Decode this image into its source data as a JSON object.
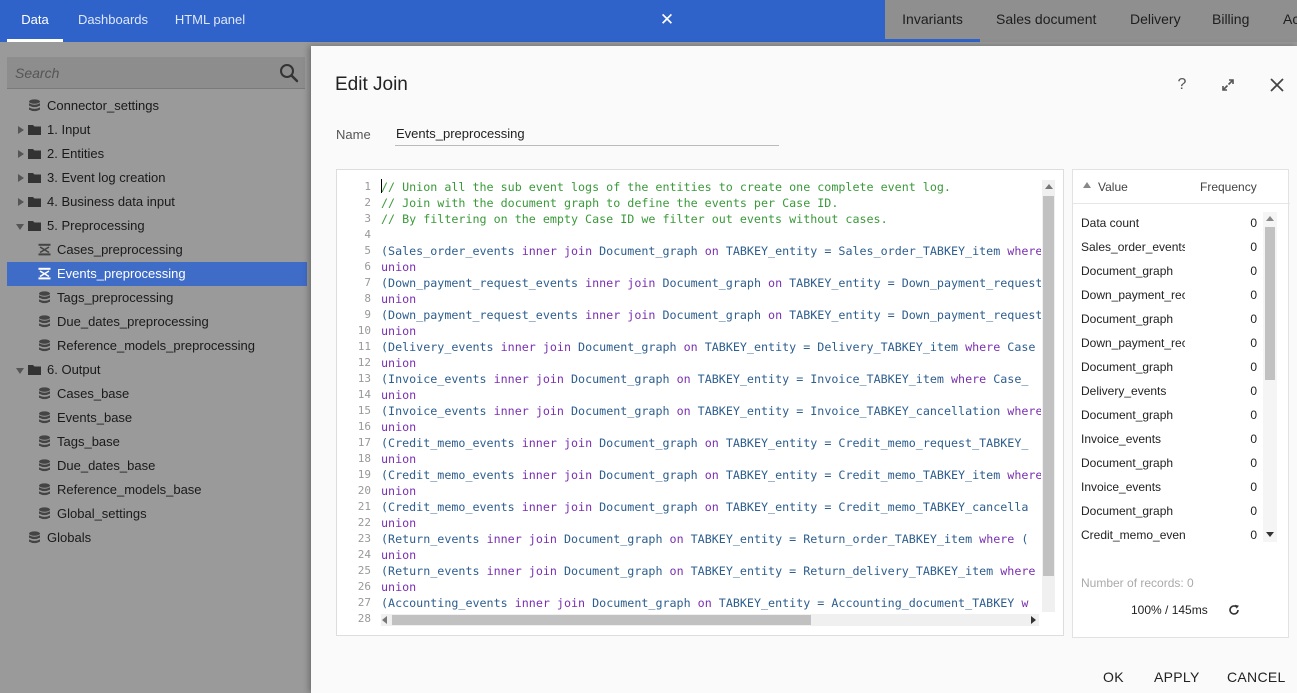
{
  "topbar": {
    "tabs": [
      "Data",
      "Dashboards",
      "HTML panel"
    ],
    "active_tab": "Data",
    "close_icon": "close-icon"
  },
  "right_tabs": [
    "Invariants",
    "Sales document",
    "Delivery",
    "Billing",
    "Ac"
  ],
  "search": {
    "placeholder": "Search",
    "value": ""
  },
  "tree": [
    {
      "label": "Connector_settings",
      "icon": "database-icon",
      "depth": 0,
      "arrow": "none"
    },
    {
      "label": "1. Input",
      "icon": "folder-icon",
      "depth": 0,
      "arrow": "right"
    },
    {
      "label": "2. Entities",
      "icon": "folder-icon",
      "depth": 0,
      "arrow": "right"
    },
    {
      "label": "3. Event log creation",
      "icon": "folder-icon",
      "depth": 0,
      "arrow": "right"
    },
    {
      "label": "4. Business data input",
      "icon": "folder-icon",
      "depth": 0,
      "arrow": "right"
    },
    {
      "label": "5. Preprocessing",
      "icon": "folder-icon",
      "depth": 0,
      "arrow": "down"
    },
    {
      "label": "Cases_preprocessing",
      "icon": "join-icon",
      "depth": 1,
      "arrow": "none"
    },
    {
      "label": "Events_preprocessing",
      "icon": "join-icon",
      "depth": 1,
      "arrow": "none",
      "selected": true
    },
    {
      "label": "Tags_preprocessing",
      "icon": "database-icon",
      "depth": 1,
      "arrow": "none"
    },
    {
      "label": "Due_dates_preprocessing",
      "icon": "database-icon",
      "depth": 1,
      "arrow": "none"
    },
    {
      "label": "Reference_models_preprocessing",
      "icon": "database-icon",
      "depth": 1,
      "arrow": "none"
    },
    {
      "label": "6. Output",
      "icon": "folder-icon",
      "depth": 0,
      "arrow": "down"
    },
    {
      "label": "Cases_base",
      "icon": "database-icon",
      "depth": 1,
      "arrow": "none"
    },
    {
      "label": "Events_base",
      "icon": "database-icon",
      "depth": 1,
      "arrow": "none"
    },
    {
      "label": "Tags_base",
      "icon": "database-icon",
      "depth": 1,
      "arrow": "none"
    },
    {
      "label": "Due_dates_base",
      "icon": "database-icon",
      "depth": 1,
      "arrow": "none"
    },
    {
      "label": "Reference_models_base",
      "icon": "database-icon",
      "depth": 1,
      "arrow": "none"
    },
    {
      "label": "Global_settings",
      "icon": "database-icon",
      "depth": 1,
      "arrow": "none"
    },
    {
      "label": "Globals",
      "icon": "database-icon",
      "depth": 0,
      "arrow": "none"
    }
  ],
  "dialog": {
    "title": "Edit Join",
    "help_label": "?",
    "name_label": "Name",
    "name_value": "Events_preprocessing",
    "buttons": {
      "ok": "OK",
      "apply": "APPLY",
      "cancel": "CANCEL"
    }
  },
  "code_lines": [
    [
      [
        "cm",
        "// Union all the sub event logs of the entities to create one complete event log."
      ]
    ],
    [
      [
        "cm",
        "// Join with the document graph to define the events per Case ID."
      ]
    ],
    [
      [
        "cm",
        "// By filtering on the empty Case ID we filter out events without cases."
      ]
    ],
    [],
    [
      [
        "id",
        "(Sales_order_events "
      ],
      [
        "kw",
        "inner join"
      ],
      [
        "id",
        " Document_graph "
      ],
      [
        "kw",
        "on"
      ],
      [
        "id",
        " TABKEY_entity = Sales_order_TABKEY_item "
      ],
      [
        "kw",
        "where"
      ]
    ],
    [
      [
        "kw",
        "union"
      ]
    ],
    [
      [
        "id",
        "(Down_payment_request_events "
      ],
      [
        "kw",
        "inner join"
      ],
      [
        "id",
        " Document_graph "
      ],
      [
        "kw",
        "on"
      ],
      [
        "id",
        " TABKEY_entity = Down_payment_request"
      ]
    ],
    [
      [
        "kw",
        "union"
      ]
    ],
    [
      [
        "id",
        "(Down_payment_request_events "
      ],
      [
        "kw",
        "inner join"
      ],
      [
        "id",
        " Document_graph "
      ],
      [
        "kw",
        "on"
      ],
      [
        "id",
        " TABKEY_entity = Down_payment_request"
      ]
    ],
    [
      [
        "kw",
        "union"
      ]
    ],
    [
      [
        "id",
        "(Delivery_events "
      ],
      [
        "kw",
        "inner join"
      ],
      [
        "id",
        " Document_graph "
      ],
      [
        "kw",
        "on"
      ],
      [
        "id",
        " TABKEY_entity = Delivery_TABKEY_item "
      ],
      [
        "kw",
        "where"
      ],
      [
        "id",
        " Case"
      ]
    ],
    [
      [
        "kw",
        "union"
      ]
    ],
    [
      [
        "id",
        "(Invoice_events "
      ],
      [
        "kw",
        "inner join"
      ],
      [
        "id",
        " Document_graph "
      ],
      [
        "kw",
        "on"
      ],
      [
        "id",
        " TABKEY_entity = Invoice_TABKEY_item "
      ],
      [
        "kw",
        "where"
      ],
      [
        "id",
        " Case_"
      ]
    ],
    [
      [
        "kw",
        "union"
      ]
    ],
    [
      [
        "id",
        "(Invoice_events "
      ],
      [
        "kw",
        "inner join"
      ],
      [
        "id",
        " Document_graph "
      ],
      [
        "kw",
        "on"
      ],
      [
        "id",
        " TABKEY_entity = Invoice_TABKEY_cancellation "
      ],
      [
        "kw",
        "where"
      ]
    ],
    [
      [
        "kw",
        "union"
      ]
    ],
    [
      [
        "id",
        "(Credit_memo_events "
      ],
      [
        "kw",
        "inner join"
      ],
      [
        "id",
        " Document_graph "
      ],
      [
        "kw",
        "on"
      ],
      [
        "id",
        " TABKEY_entity = Credit_memo_request_TABKEY_"
      ]
    ],
    [
      [
        "kw",
        "union"
      ]
    ],
    [
      [
        "id",
        "(Credit_memo_events "
      ],
      [
        "kw",
        "inner join"
      ],
      [
        "id",
        " Document_graph "
      ],
      [
        "kw",
        "on"
      ],
      [
        "id",
        " TABKEY_entity = Credit_memo_TABKEY_item "
      ],
      [
        "kw",
        "where"
      ]
    ],
    [
      [
        "kw",
        "union"
      ]
    ],
    [
      [
        "id",
        "(Credit_memo_events "
      ],
      [
        "kw",
        "inner join"
      ],
      [
        "id",
        " Document_graph "
      ],
      [
        "kw",
        "on"
      ],
      [
        "id",
        " TABKEY_entity = Credit_memo_TABKEY_cancella"
      ]
    ],
    [
      [
        "kw",
        "union"
      ]
    ],
    [
      [
        "id",
        "(Return_events "
      ],
      [
        "kw",
        "inner join"
      ],
      [
        "id",
        " Document_graph "
      ],
      [
        "kw",
        "on"
      ],
      [
        "id",
        " TABKEY_entity = Return_order_TABKEY_item "
      ],
      [
        "kw",
        "where"
      ],
      [
        "id",
        " ("
      ]
    ],
    [
      [
        "kw",
        "union"
      ]
    ],
    [
      [
        "id",
        "(Return_events "
      ],
      [
        "kw",
        "inner join"
      ],
      [
        "id",
        " Document_graph "
      ],
      [
        "kw",
        "on"
      ],
      [
        "id",
        " TABKEY_entity = Return_delivery_TABKEY_item "
      ],
      [
        "kw",
        "where"
      ]
    ],
    [
      [
        "kw",
        "union"
      ]
    ],
    [
      [
        "id",
        "(Accounting_events "
      ],
      [
        "kw",
        "inner join"
      ],
      [
        "id",
        " Document_graph "
      ],
      [
        "kw",
        "on"
      ],
      [
        "id",
        " TABKEY_entity = Accounting_document_TABKEY "
      ],
      [
        "kw",
        "w"
      ]
    ],
    []
  ],
  "results": {
    "value_header": "Value",
    "frequency_header": "Frequency",
    "rows": [
      {
        "value": "Data count",
        "frequency": "0"
      },
      {
        "value": "Sales_order_events",
        "frequency": "0"
      },
      {
        "value": "Document_graph",
        "frequency": "0"
      },
      {
        "value": "Down_payment_rec",
        "frequency": "0"
      },
      {
        "value": "Document_graph",
        "frequency": "0"
      },
      {
        "value": "Down_payment_rec",
        "frequency": "0"
      },
      {
        "value": "Document_graph",
        "frequency": "0"
      },
      {
        "value": "Delivery_events",
        "frequency": "0"
      },
      {
        "value": "Document_graph",
        "frequency": "0"
      },
      {
        "value": "Invoice_events",
        "frequency": "0"
      },
      {
        "value": "Document_graph",
        "frequency": "0"
      },
      {
        "value": "Invoice_events",
        "frequency": "0"
      },
      {
        "value": "Document_graph",
        "frequency": "0"
      },
      {
        "value": "Credit_memo_even",
        "frequency": "0"
      }
    ],
    "record_count": "Number of records: 0",
    "timing": "100% / 145ms"
  }
}
